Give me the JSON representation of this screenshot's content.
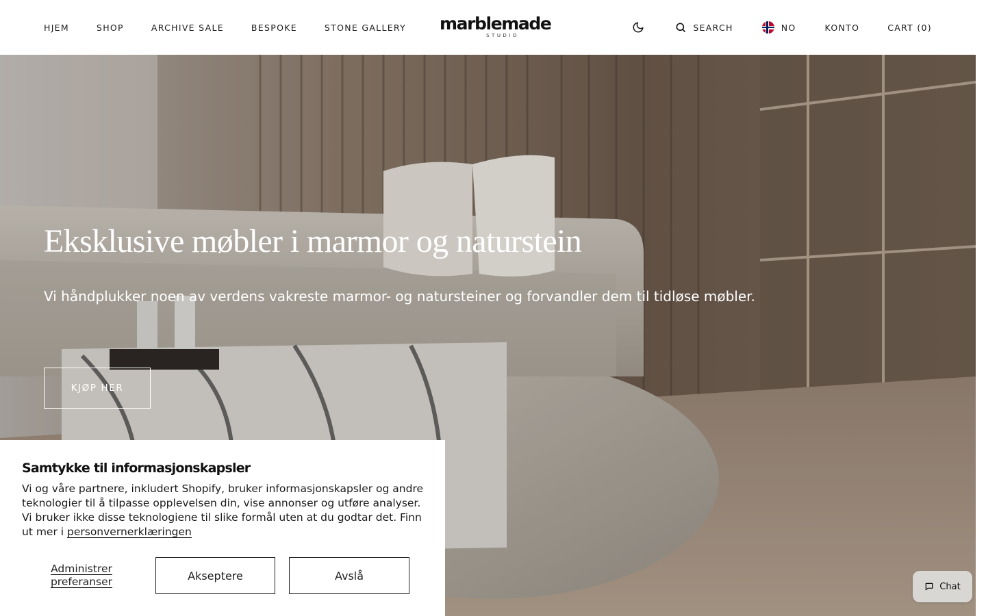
{
  "header": {
    "nav": [
      {
        "label": "HJEM"
      },
      {
        "label": "SHOP"
      },
      {
        "label": "ARCHIVE SALE"
      },
      {
        "label": "BESPOKE"
      },
      {
        "label": "STONE GALLERY"
      }
    ],
    "logo": {
      "word": "marblemade",
      "sub": "STUDIO"
    },
    "theme_icon": "moon-icon",
    "search_label": "SEARCH",
    "search_icon": "search-icon",
    "language": {
      "code": "NO",
      "flag": "norway-flag-icon"
    },
    "account_label": "KONTO",
    "cart_label": "CART (0)"
  },
  "hero": {
    "title": "Eksklusive møbler i marmor og naturstein",
    "subtitle": "Vi håndplukker noen av verdens vakreste marmor- og natursteiner og forvandler dem til tidløse møbler.",
    "cta_label": "KJØP HER"
  },
  "cookie": {
    "title": "Samtykke til informasjonskapsler",
    "text": "Vi og våre partnere, inkludert Shopify, bruker informasjonskapsler og andre teknologier til å tilpasse opplevelsen din, vise annonser og utføre analyser. Vi bruker ikke disse teknologiene til slike formål uten at du godtar det. Finn ut mer i ",
    "link_label": "personvernerklæringen",
    "manage_label": "Administrer preferanser",
    "accept_label": "Akseptere",
    "decline_label": "Avslå"
  },
  "chat": {
    "label": "Chat",
    "icon": "chat-bubble-icon"
  },
  "colors": {
    "text": "#111111",
    "hero_text": "#ffffff",
    "chat_bg": "#d9d7d4"
  }
}
